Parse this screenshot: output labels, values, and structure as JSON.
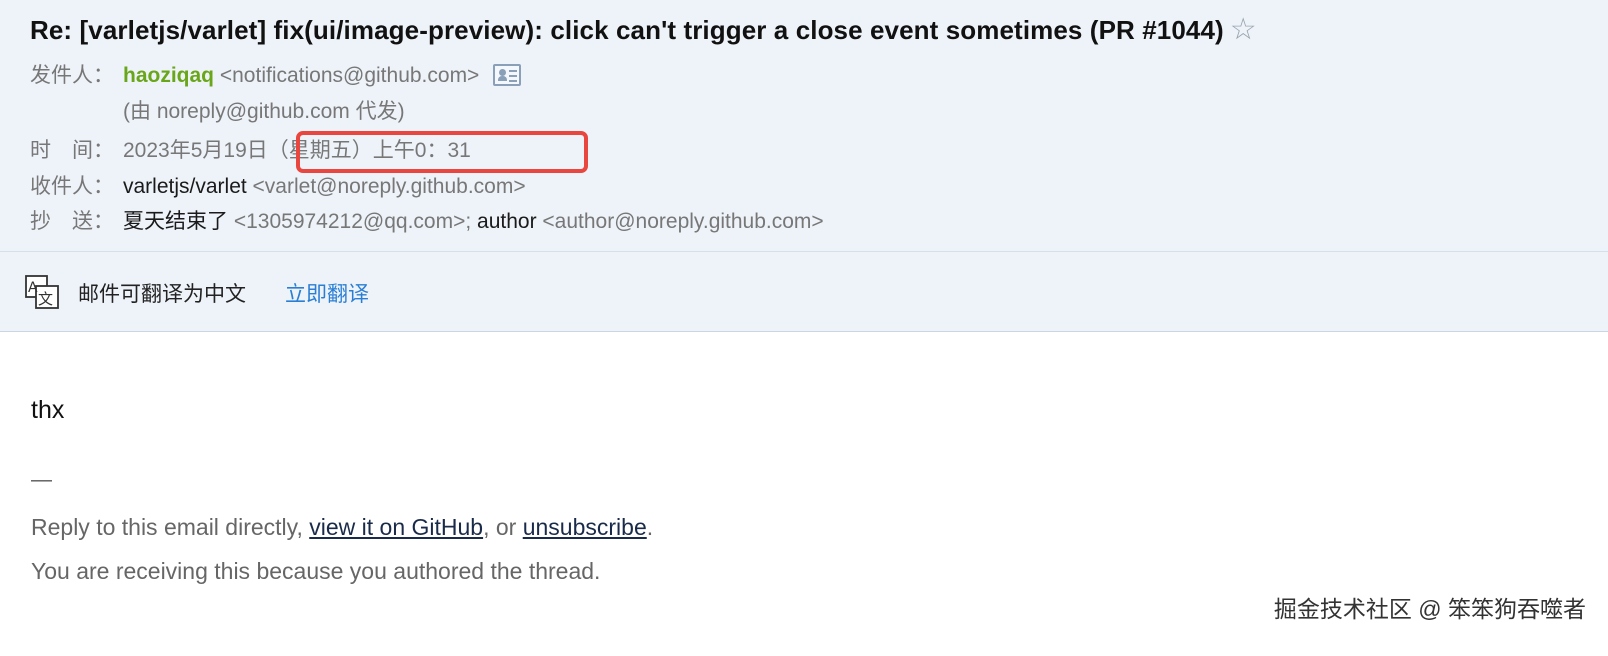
{
  "email": {
    "subject": "Re: [varletjs/varlet] fix(ui/image-preview): click can't trigger a close event sometimes (PR #1044)",
    "star_glyph": "☆",
    "from": {
      "label": "发件人：",
      "name": "haoziqaq",
      "address": "<notifications@github.com>",
      "via": "(由 noreply@github.com 代发)"
    },
    "time": {
      "label": "时　间：",
      "date": "2023年5月19日",
      "weekday_time": "（星期五）上午0：31"
    },
    "to": {
      "label": "收件人：",
      "name": "varletjs/varlet",
      "address": "<varlet@noreply.github.com>"
    },
    "cc": {
      "label": "抄　送：",
      "name1": "夏天结束了",
      "address1": "<1305974212@qq.com>;",
      "name2": "author",
      "address2": "<author@noreply.github.com>"
    }
  },
  "translate": {
    "text": "邮件可翻译为中文",
    "link": "立即翻译"
  },
  "message": {
    "body": "thx",
    "separator": "—",
    "reply_prefix": "Reply to this email directly, ",
    "view_link": "view it on GitHub",
    "reply_middle": ", or ",
    "unsubscribe_link": "unsubscribe",
    "reply_suffix": ".",
    "receiving_reason": "You are receiving this because you authored the thread."
  },
  "watermark": "掘金技术社区 @ 笨笨狗吞噬者",
  "colors": {
    "header_bg": "#eef3f9",
    "sender_green": "#6aa61a",
    "link_blue": "#2a7fd4",
    "highlight_red": "#e9463f"
  }
}
